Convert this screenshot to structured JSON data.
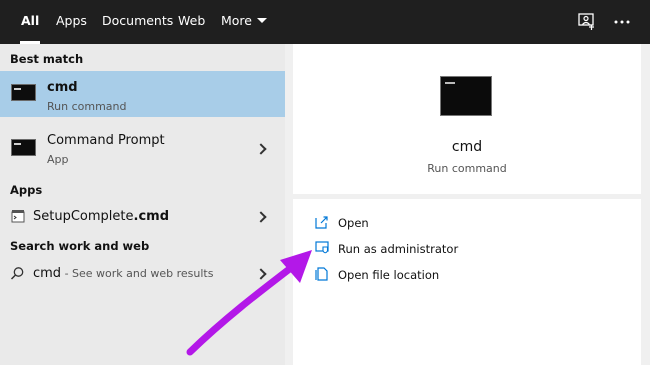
{
  "tabs": [
    {
      "label": "All"
    },
    {
      "label": "Apps"
    },
    {
      "label": "Documents"
    },
    {
      "label": "Web"
    },
    {
      "label": "More"
    }
  ],
  "icons": {
    "feedback": "feedback-icon",
    "options": "more-options-icon"
  },
  "left": {
    "best_match_header": "Best match",
    "best_match": {
      "title": "cmd",
      "subtitle": "Run command"
    },
    "command_prompt": {
      "title": "Command Prompt",
      "subtitle": "App"
    },
    "apps_header": "Apps",
    "setup": {
      "title_prefix": "SetupComplete",
      "title_bold": ".cmd"
    },
    "web_header": "Search work and web",
    "web_result": {
      "query": "cmd",
      "suffix": " - See work and web results"
    }
  },
  "preview": {
    "title": "cmd",
    "subtitle": "Run command"
  },
  "actions": [
    {
      "label": "Open",
      "icon": "open-icon"
    },
    {
      "label": "Run as administrator",
      "icon": "shield-icon"
    },
    {
      "label": "Open file location",
      "icon": "file-location-icon"
    }
  ],
  "colors": {
    "selected_row": "#a8cde8",
    "accent": "#0078d7",
    "annotation_arrow": "#b318e8"
  }
}
